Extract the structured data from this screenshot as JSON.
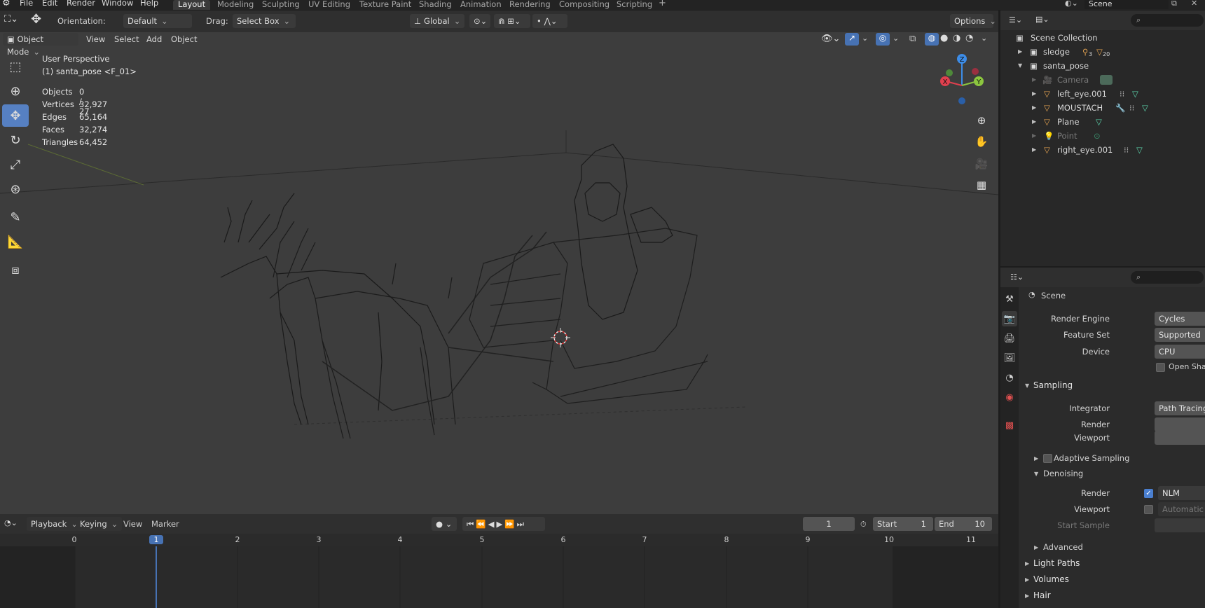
{
  "menu": {
    "items": [
      "File",
      "Edit",
      "Render",
      "Window",
      "Help"
    ],
    "workspaces": [
      "Layout",
      "Modeling",
      "Sculpting",
      "UV Editing",
      "Texture Paint",
      "Shading",
      "Animation",
      "Rendering",
      "Compositing",
      "Scripting"
    ],
    "active_workspace": "Layout",
    "scene_name": "Scene"
  },
  "tool_header": {
    "orientation_label": "Orientation:",
    "orientation_value": "Default",
    "drag_label": "Drag:",
    "drag_value": "Select Box",
    "transform_orientation": "Global",
    "options": "Options"
  },
  "viewport": {
    "mode": "Object Mode",
    "menus": [
      "View",
      "Select",
      "Add",
      "Object"
    ],
    "perspective_title": "User Perspective",
    "active_object": "(1) santa_pose <F_01>",
    "stats": [
      {
        "label": "Objects",
        "value": "0 / 27"
      },
      {
        "label": "Vertices",
        "value": "32,927"
      },
      {
        "label": "Edges",
        "value": "65,164"
      },
      {
        "label": "Faces",
        "value": "32,274"
      },
      {
        "label": "Triangles",
        "value": "64,452"
      }
    ],
    "gizmo": {
      "x": "X",
      "y": "Y",
      "z": "Z"
    }
  },
  "timeline": {
    "menus": [
      "Playback",
      "Keying",
      "View",
      "Marker"
    ],
    "current_frame": "1",
    "start_label": "Start",
    "start": "1",
    "end_label": "End",
    "end": "10",
    "ticks": [
      "0",
      "1",
      "2",
      "3",
      "4",
      "5",
      "6",
      "7",
      "8",
      "9",
      "10",
      "11"
    ]
  },
  "outliner": {
    "root": "Scene Collection",
    "items": [
      {
        "name": "sledge",
        "depth": 0,
        "expanded": false,
        "badge1": "3",
        "badge2": "20"
      },
      {
        "name": "santa_pose",
        "depth": 0,
        "expanded": true
      },
      {
        "name": "Camera",
        "depth": 1,
        "dim": true
      },
      {
        "name": "left_eye.001",
        "depth": 1
      },
      {
        "name": "MOUSTACH",
        "depth": 1
      },
      {
        "name": "Plane",
        "depth": 1
      },
      {
        "name": "Point",
        "depth": 1,
        "dim": true
      },
      {
        "name": "right_eye.001",
        "depth": 1
      }
    ]
  },
  "properties": {
    "context": "Scene",
    "render_engine_label": "Render Engine",
    "render_engine": "Cycles",
    "feature_set_label": "Feature Set",
    "feature_set": "Supported",
    "device_label": "Device",
    "device": "CPU",
    "open_shading": "Open Shadin",
    "sampling": "Sampling",
    "integrator_label": "Integrator",
    "integrator": "Path Tracing",
    "render_label": "Render",
    "viewport_label": "Viewport",
    "adaptive_sampling": "Adaptive Sampling",
    "denoising": "Denoising",
    "denoise_render_label": "Render",
    "denoise_render_value": "NLM",
    "denoise_viewport_label": "Viewport",
    "denoise_viewport_value": "Automatic",
    "start_sample_label": "Start Sample",
    "advanced": "Advanced",
    "light_paths": "Light Paths",
    "volumes": "Volumes",
    "hair": "Hair"
  },
  "colors": {
    "accent": "#5680c2",
    "x_axis": "#e0404e",
    "y_axis": "#8cc63f",
    "z_axis": "#3d8de8"
  }
}
